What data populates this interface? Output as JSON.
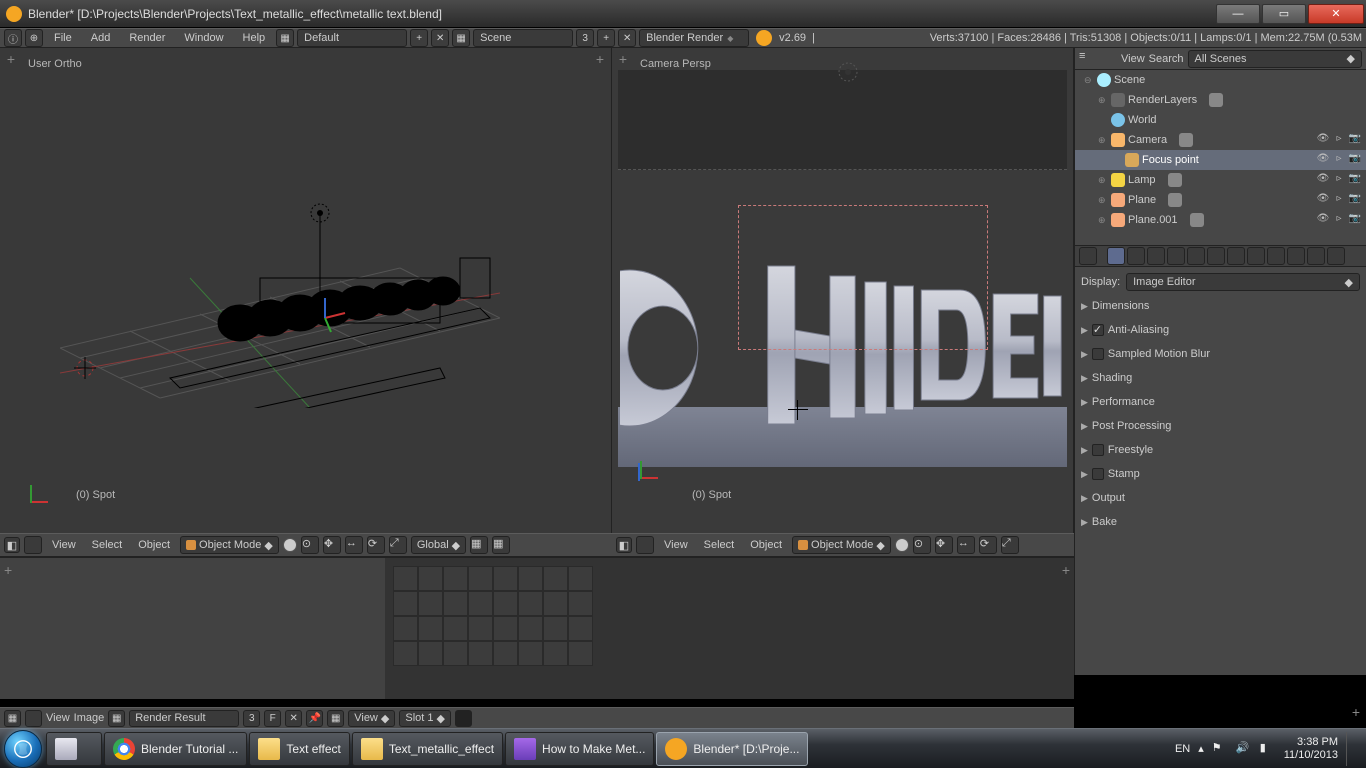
{
  "window": {
    "title": "Blender* [D:\\Projects\\Blender\\Projects\\Text_metallic_effect\\metallic text.blend]",
    "btns": {
      "min": "—",
      "max": "▭",
      "close": "✕"
    }
  },
  "topbar": {
    "menus": [
      "File",
      "Add",
      "Render",
      "Window",
      "Help"
    ],
    "layout": "Default",
    "scene_label": "Scene",
    "scene_count": "3",
    "renderer": "Blender Render",
    "version": "v2.69",
    "stats": "Verts:37100 | Faces:28486 | Tris:51308 | Objects:0/11 | Lamps:0/1 | Mem:22.75M (0.53M"
  },
  "vp_left": {
    "label": "User Ortho",
    "spot": "(0) Spot"
  },
  "vp_right": {
    "label": "Camera Persp",
    "spot": "(0) Spot",
    "text3d": "OHIIDEN"
  },
  "vph": {
    "menus": [
      "View",
      "Select",
      "Object"
    ],
    "mode": "Object Mode",
    "orient": "Global"
  },
  "outliner": {
    "menus": [
      "View",
      "Search"
    ],
    "filter": "All Scenes",
    "tree": [
      {
        "ind": 0,
        "exp": "⊖",
        "icon": "scene",
        "label": "Scene",
        "ric": false
      },
      {
        "ind": 1,
        "exp": "⊕",
        "icon": "render",
        "label": "RenderLayers",
        "ric": false,
        "extra": true
      },
      {
        "ind": 1,
        "exp": "",
        "icon": "world",
        "label": "World",
        "ric": false
      },
      {
        "ind": 1,
        "exp": "⊕",
        "icon": "cam",
        "label": "Camera",
        "ric": true,
        "extra": true
      },
      {
        "ind": 2,
        "exp": "",
        "icon": "empty",
        "label": "Focus point",
        "ric": true,
        "sel": true
      },
      {
        "ind": 1,
        "exp": "⊕",
        "icon": "lamp",
        "label": "Lamp",
        "ric": true,
        "extra": true
      },
      {
        "ind": 1,
        "exp": "⊕",
        "icon": "mesh",
        "label": "Plane",
        "ric": true,
        "extra": true
      },
      {
        "ind": 1,
        "exp": "⊕",
        "icon": "mesh",
        "label": "Plane.001",
        "ric": true,
        "extra": true
      }
    ]
  },
  "props": {
    "display_label": "Display:",
    "display_value": "Image Editor",
    "panels": [
      {
        "label": "Dimensions",
        "cb": null
      },
      {
        "label": "Anti-Aliasing",
        "cb": true
      },
      {
        "label": "Sampled Motion Blur",
        "cb": false
      },
      {
        "label": "Shading",
        "cb": null
      },
      {
        "label": "Performance",
        "cb": null
      },
      {
        "label": "Post Processing",
        "cb": null
      },
      {
        "label": "Freestyle",
        "cb": false
      },
      {
        "label": "Stamp",
        "cb": false
      },
      {
        "label": "Output",
        "cb": null
      },
      {
        "label": "Bake",
        "cb": null
      }
    ]
  },
  "imgeditor": {
    "menus": [
      "View",
      "Image"
    ],
    "result": "Render Result",
    "count": "3",
    "f": "F",
    "view": "View",
    "slot": "Slot 1"
  },
  "taskbar": {
    "items": [
      {
        "icon": "img",
        "label": ""
      },
      {
        "icon": "chrome",
        "label": "Blender Tutorial ..."
      },
      {
        "icon": "folder",
        "label": "Text effect"
      },
      {
        "icon": "folder",
        "label": "Text_metallic_effect"
      },
      {
        "icon": "video",
        "label": "How to Make Met..."
      },
      {
        "icon": "blender",
        "label": "Blender* [D:\\Proje...",
        "act": true
      }
    ],
    "lang": "EN",
    "time": "3:38 PM",
    "date": "11/10/2013"
  }
}
